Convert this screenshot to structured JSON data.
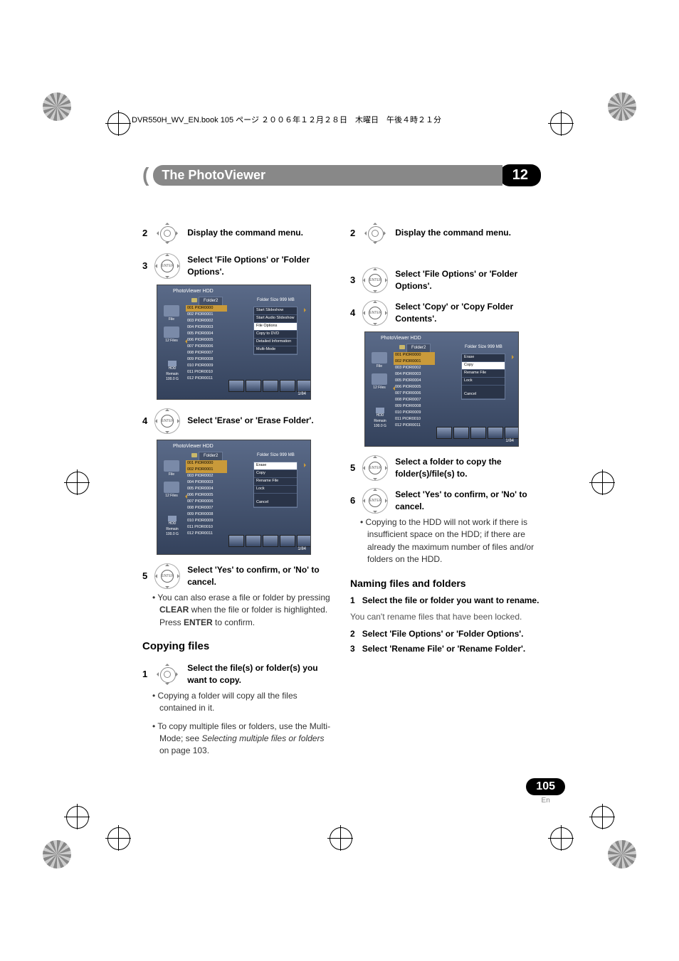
{
  "book_header": "DVR550H_WV_EN.book  105 ページ  ２００６年１２月２８日　木曜日　午後４時２１分",
  "chapter": {
    "title": "The PhotoViewer",
    "number": "12"
  },
  "enter_label": "ENTER",
  "left_col": {
    "step2": {
      "n": "2",
      "text": "Display the command menu."
    },
    "step3": {
      "n": "3",
      "text": "Select 'File Options' or 'Folder Options'."
    },
    "step4": {
      "n": "4",
      "text": "Select 'Erase' or 'Erase Folder'."
    },
    "step5": {
      "n": "5",
      "text": "Select 'Yes' to confirm, or 'No' to cancel."
    },
    "bullet5": "You can also erase a file or folder by pressing ",
    "bullet5_clear": "CLEAR",
    "bullet5_cont": " when the file or folder is highlighted. Press ",
    "bullet5_enter": "ENTER",
    "bullet5_end": " to confirm.",
    "copy_h": "Copying files",
    "step1c": {
      "n": "1",
      "text": "Select the file(s) or folder(s) you want to copy."
    },
    "bullet1c_a": "Copying a folder will copy all the files contained in it.",
    "bullet1c_b_pre": "To copy multiple files or folders, use the Multi-Mode; see ",
    "bullet1c_b_it": "Selecting multiple files or folders",
    "bullet1c_b_post": " on page 103."
  },
  "right_col": {
    "step2": {
      "n": "2",
      "text": "Display the command menu."
    },
    "step3": {
      "n": "3",
      "text": "Select 'File Options' or 'Folder Options'."
    },
    "step4": {
      "n": "4",
      "text": "Select 'Copy' or 'Copy Folder Contents'."
    },
    "step5": {
      "n": "5",
      "text": "Select a folder to copy the folder(s)/file(s) to."
    },
    "step6": {
      "n": "6",
      "text": "Select 'Yes' to confirm, or 'No' to cancel."
    },
    "bullet6": "Copying to the HDD will not work if there is insufficient space on the HDD; if there are already the maximum number of files and/or folders on the HDD.",
    "naming_h": "Naming files and folders",
    "step1n": {
      "n": "1",
      "text": "Select the file or folder you want to rename."
    },
    "note1n": "You can't rename files that have been locked.",
    "step2n": {
      "n": "2",
      "text": "Select 'File Options' or 'Folder Options'."
    },
    "step3n": {
      "n": "3",
      "text": "Select 'Rename File' or 'Rename Folder'."
    }
  },
  "pv": {
    "title": "PhotoViewer  HDD",
    "folder": "Folder2",
    "size": "Folder Size 999 MB",
    "side_file": "File",
    "side_files": "12 Files",
    "hdd": "HDD",
    "remain": "Remain",
    "remain_val": "100.0 G",
    "counter": "1/84",
    "list": [
      "001 PIOR0000",
      "002 PIOR0001",
      "003 PIOR0002",
      "004 PIOR0003",
      "005 PIOR0004",
      "006 PIOR0005",
      "007 PIOR0006",
      "008 PIOR0007",
      "009 PIOR0008",
      "010 PIOR0009",
      "011 PIOR0010",
      "012 PIOR0011"
    ],
    "menu_a": [
      "Start Slideshow",
      "Start Audio Slideshow",
      "File Options",
      "Copy to DVD",
      "Detailed Information",
      "Multi-Mode"
    ],
    "menu_b": [
      "Erase",
      "Copy",
      "Rename File",
      "Lock",
      "Cancel"
    ]
  },
  "page_number": "105",
  "page_lang": "En"
}
